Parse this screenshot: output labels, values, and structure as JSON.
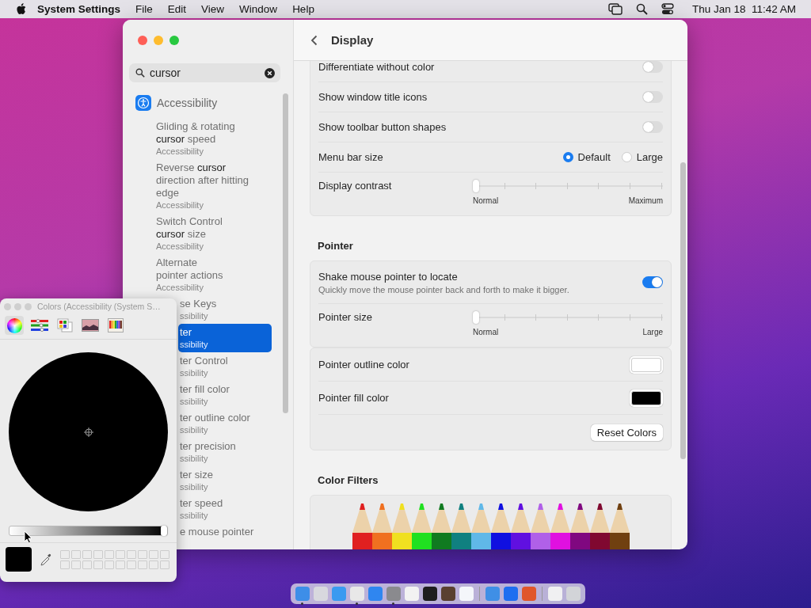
{
  "menu_bar": {
    "app_name": "System Settings",
    "menus": [
      "File",
      "Edit",
      "View",
      "Window",
      "Help"
    ],
    "clock": "Thu Jan 18  11:42 AM"
  },
  "settings_window": {
    "search": {
      "value": "cursor"
    },
    "sidebar": {
      "category": "Accessibility",
      "results": [
        {
          "title": [
            "Gliding & rotating",
            "**cursor** speed"
          ],
          "subtitle": "Accessibility",
          "selected": false,
          "covered": false
        },
        {
          "title": [
            "Reverse **cursor**",
            "direction after hitting",
            "edge"
          ],
          "subtitle": "Accessibility",
          "selected": false,
          "covered": false
        },
        {
          "title": [
            "Switch Control",
            "**cursor** size"
          ],
          "subtitle": "Accessibility",
          "selected": false,
          "covered": false
        },
        {
          "title": [
            "Alternate",
            "pointer actions"
          ],
          "subtitle": "Accessibility",
          "selected": false,
          "covered": false
        },
        {
          "title": [
            "se Keys"
          ],
          "subtitle": "ssibility",
          "selected": false,
          "covered": true
        },
        {
          "title": [
            "ter"
          ],
          "subtitle": "ssibility",
          "selected": true,
          "covered": true
        },
        {
          "title": [
            "ter Control"
          ],
          "subtitle": "ssibility",
          "selected": false,
          "covered": true
        },
        {
          "title": [
            "ter fill color"
          ],
          "subtitle": "ssibility",
          "selected": false,
          "covered": true
        },
        {
          "title": [
            "ter outline color"
          ],
          "subtitle": "ssibility",
          "selected": false,
          "covered": true
        },
        {
          "title": [
            "ter precision"
          ],
          "subtitle": "ssibility",
          "selected": false,
          "covered": true
        },
        {
          "title": [
            "ter size"
          ],
          "subtitle": "ssibility",
          "selected": false,
          "covered": true
        },
        {
          "title": [
            "ter speed"
          ],
          "subtitle": "ssibility",
          "selected": false,
          "covered": true
        },
        {
          "title": [
            "e mouse pointer"
          ],
          "selected": false,
          "covered": true
        }
      ]
    },
    "page_title": "Display",
    "groups": [
      {
        "rows": [
          {
            "kind": "toggle",
            "label": "Differentiate without color",
            "on": false
          },
          {
            "kind": "toggle",
            "label": "Show window title icons",
            "on": false
          },
          {
            "kind": "toggle",
            "label": "Show toolbar button shapes",
            "on": false
          },
          {
            "kind": "radio",
            "label": "Menu bar size",
            "options": [
              {
                "label": "Default",
                "selected": true
              },
              {
                "label": "Large",
                "selected": false
              }
            ]
          },
          {
            "kind": "slider",
            "label": "Display contrast",
            "level": 0,
            "min_label": "Normal",
            "max_label": "Maximum"
          }
        ]
      },
      {
        "heading": "Pointer",
        "rows": [
          {
            "kind": "toggle",
            "label": "Shake mouse pointer to locate",
            "description": "Quickly move the mouse pointer back and forth to make it bigger.",
            "on": true
          },
          {
            "kind": "slider",
            "label": "Pointer size",
            "level": 0,
            "min_label": "Normal",
            "max_label": "Large"
          }
        ]
      },
      {
        "rows": [
          {
            "kind": "swatch",
            "label": "Pointer outline color",
            "color": "#ffffff"
          },
          {
            "kind": "swatch",
            "label": "Pointer fill color",
            "color": "#000000"
          },
          {
            "kind": "button",
            "label": "Reset Colors"
          }
        ]
      },
      {
        "heading": "Color Filters",
        "rows": [
          {
            "kind": "pencils"
          }
        ]
      }
    ]
  },
  "colors_panel": {
    "title": "Colors (Accessibility (System S…",
    "modes": [
      {
        "kind": "wheel",
        "selected": true
      },
      {
        "kind": "sliders",
        "selected": false
      },
      {
        "kind": "palettes",
        "selected": false
      },
      {
        "kind": "image",
        "selected": false
      },
      {
        "kind": "pencils",
        "selected": false
      }
    ],
    "brightness": {
      "level": 1
    },
    "color": "#000000"
  },
  "dock": {
    "groups": [
      [
        {
          "color": "#3d8ee8",
          "running": true
        },
        {
          "color": "#d8d8de",
          "running": false
        },
        {
          "color": "#3a9af0",
          "running": false
        },
        {
          "color": "#e8e8e8",
          "running": true
        },
        {
          "color": "#2f86f0",
          "running": false
        },
        {
          "color": "#8a8a8e",
          "running": true
        },
        {
          "color": "#f2f2f2",
          "running": false
        },
        {
          "color": "#1e1e1e",
          "running": false
        },
        {
          "color": "#5a4030",
          "running": false
        },
        {
          "color": "#f4f6fa",
          "running": false
        }
      ],
      [
        {
          "color": "#3f8fe6",
          "running": false
        },
        {
          "color": "#1f6ef0",
          "running": false
        },
        {
          "color": "#e0562a",
          "running": false
        }
      ],
      [
        {
          "color": "#f0f0f2",
          "running": false
        },
        {
          "color": "#d2d4d8",
          "running": false
        }
      ]
    ]
  }
}
